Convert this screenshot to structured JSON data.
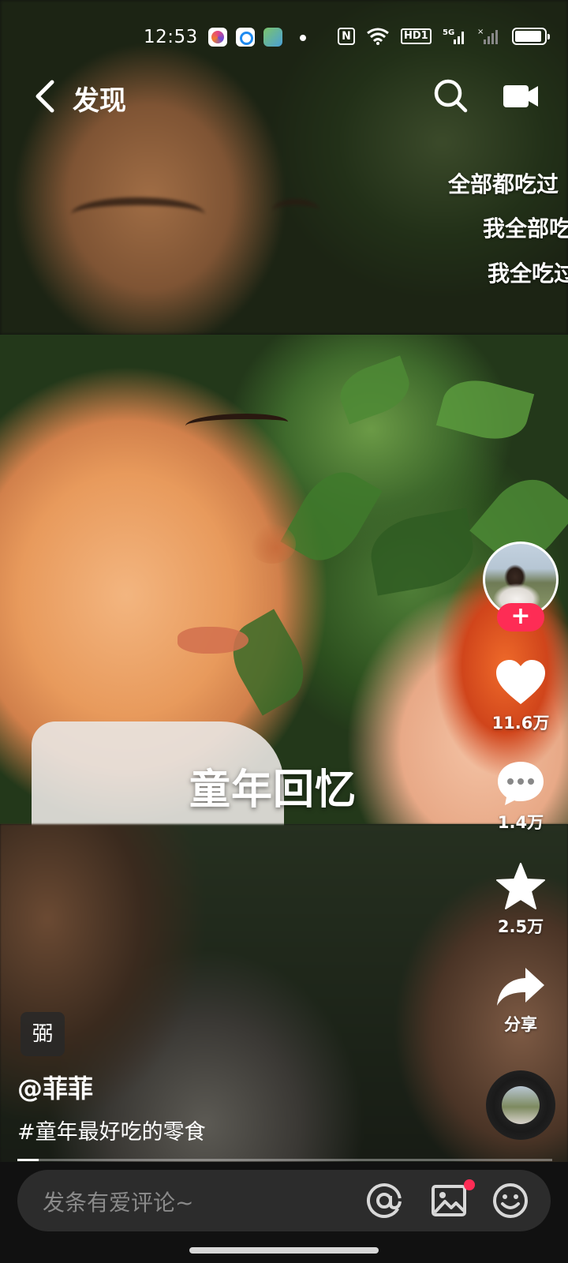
{
  "status_bar": {
    "time": "12:53",
    "network": "5G",
    "hd_label": "HD1",
    "nfc_label": "N"
  },
  "header": {
    "title": "发现"
  },
  "danmu": [
    "全部都吃过",
    "我全部吃",
    "我全吃过"
  ],
  "video": {
    "subtitle": "童年回忆"
  },
  "actions": {
    "like_count": "11.6万",
    "comment_count": "1.4万",
    "favorite_count": "2.5万",
    "share_label": "分享"
  },
  "caption": {
    "tag": "弼",
    "author": "@菲菲",
    "description": "#童年最好吃的零食"
  },
  "playback": {
    "progress": 0.04
  },
  "comment_bar": {
    "placeholder": "发条有爱评论~"
  },
  "colors": {
    "accent": "#fe2c55",
    "background": "#111111",
    "comment_bar": "#2c2c2c"
  },
  "icons": {
    "back": "chevron-left-icon",
    "search": "search-icon",
    "camera": "video-camera-icon",
    "like": "heart-icon",
    "comment": "comment-bubble-icon",
    "favorite": "star-icon",
    "share": "share-arrow-icon",
    "at": "at-sign-icon",
    "image": "image-icon",
    "emoji": "emoji-icon"
  }
}
